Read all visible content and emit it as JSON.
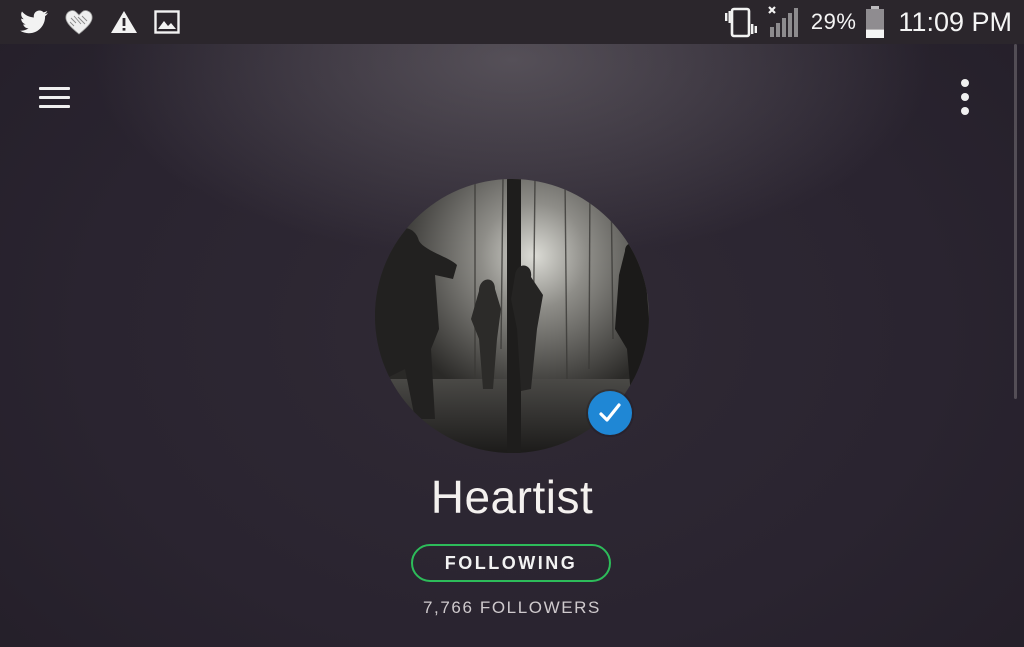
{
  "status_bar": {
    "left_icons": [
      "twitter-icon",
      "heart-icon",
      "warning-icon",
      "image-icon"
    ],
    "right_icons": [
      "vibrate-icon",
      "signal-icon",
      "battery-icon"
    ],
    "battery_percent": "29%",
    "battery_level": 0.29,
    "time": "11:09 PM"
  },
  "app_bar": {
    "menu_icon": "menu-icon",
    "more_icon": "more-vert-icon"
  },
  "artist": {
    "name": "Heartist",
    "verified": true,
    "verified_icon": "check-icon",
    "follow_label": "FOLLOWING",
    "followers_text": "7,766 FOLLOWERS"
  },
  "colors": {
    "background": "#2a2430",
    "accent_green": "#2dbc5a",
    "verified_blue": "#1f87d5",
    "text_primary": "#f4f1ef",
    "text_secondary": "#cfcacd"
  }
}
